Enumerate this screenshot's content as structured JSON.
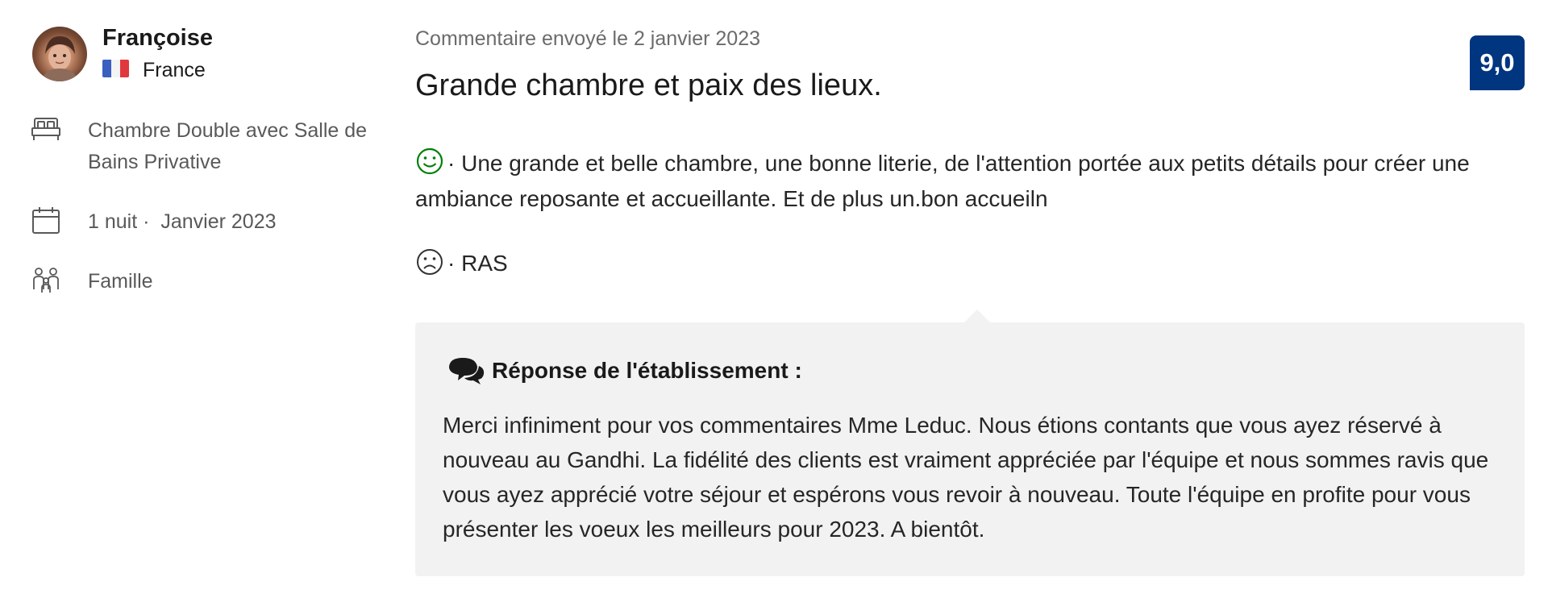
{
  "reviewer": {
    "name": "Françoise",
    "country": "France"
  },
  "stay": {
    "room": "Chambre Double avec Salle de Bains Privative",
    "nights": "1 nuit ·",
    "month": "Janvier 2023",
    "traveler_type": "Famille"
  },
  "review": {
    "sent_date": "Commentaire envoyé le 2 janvier 2023",
    "title": "Grande chambre et paix des lieux.",
    "score": "9,0",
    "positive": "· Une grande et belle chambre, une bonne literie, de l'attention portée aux petits détails pour créer une ambiance reposante et accueillante. Et de plus un.bon accueiln",
    "negative": "· RAS"
  },
  "response": {
    "heading": "Réponse de l'établissement :",
    "body": "Merci infiniment pour vos commentaires Mme Leduc. Nous étions contants que vous ayez réservé à nouveau au Gandhi. La fidélité des clients est vraiment appréciée par l'équipe et nous sommes ravis que vous ayez apprécié votre séjour et espérons vous revoir à nouveau. Toute l'équipe en profite pour vous présenter les voeux les meilleurs pour 2023. A bientôt."
  },
  "icons": {
    "room": "bed-icon",
    "stay": "calendar-icon",
    "traveler": "group-icon",
    "positive": "smile-icon",
    "negative": "frown-icon",
    "response": "speech-bubbles-icon"
  },
  "colors": {
    "score_badge": "#003580",
    "positive_icon": "#008009",
    "response_background": "#f2f2f2"
  }
}
